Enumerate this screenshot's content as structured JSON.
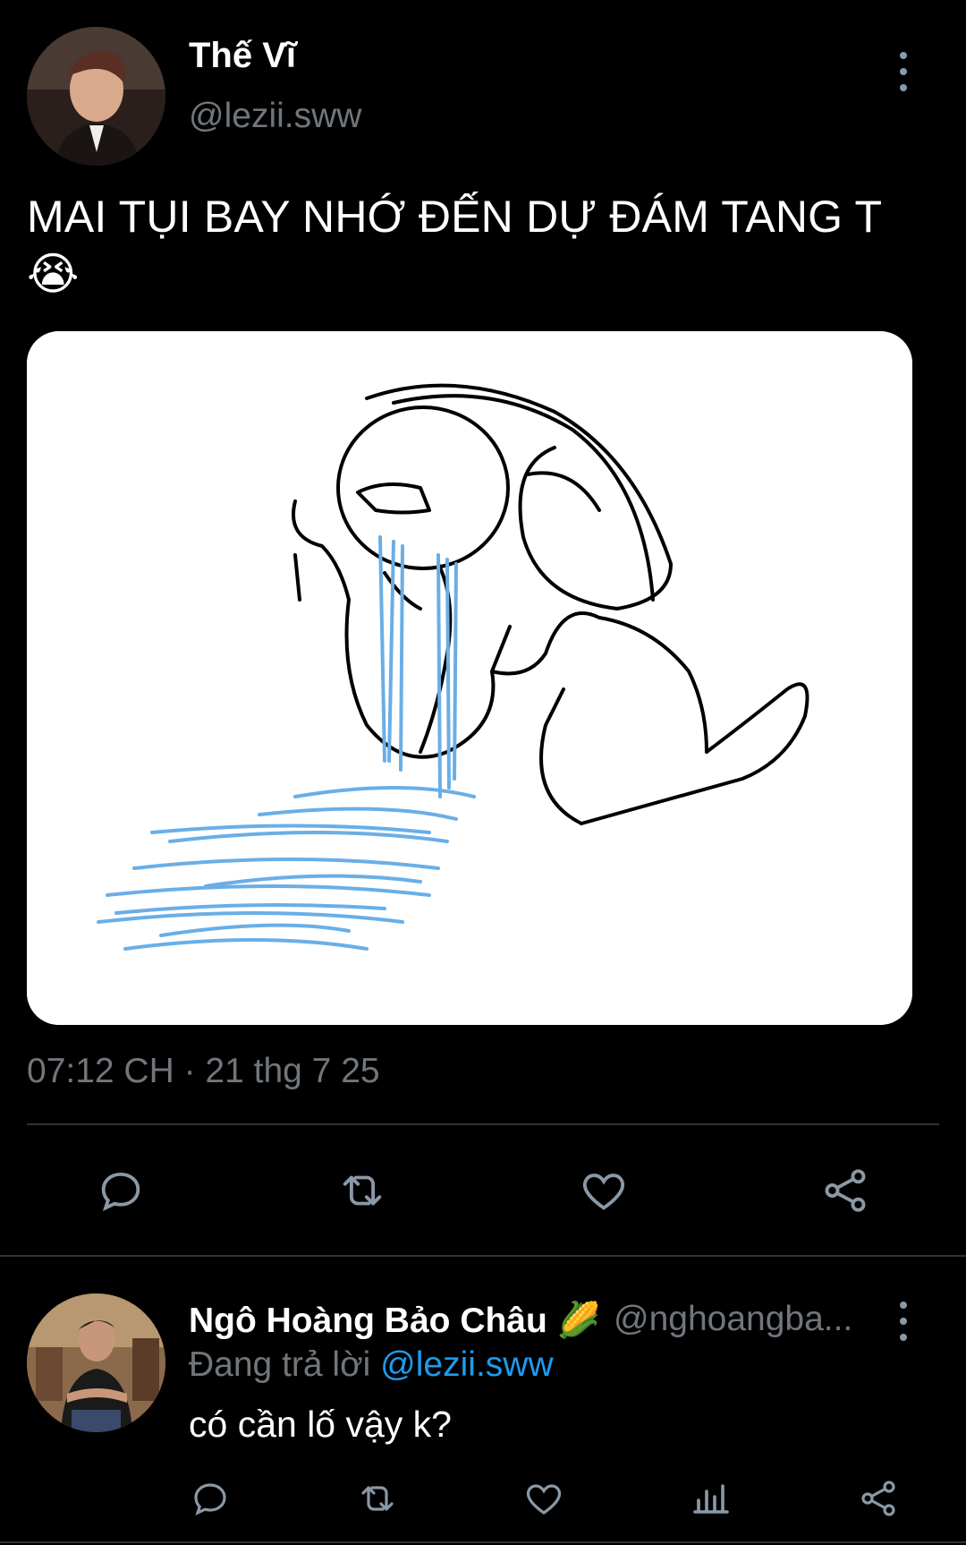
{
  "tweet": {
    "author_name": "Thế Vĩ",
    "author_handle": "@lezii.sww",
    "text": "MAI TỤI BAY NHỚ ĐẾN DỰ ĐÁM TANG T",
    "emoji": "😭",
    "timestamp": "07:12 CH · 21 thg 7 25",
    "actions": [
      "reply-icon",
      "retweet-icon",
      "like-icon",
      "share-icon"
    ]
  },
  "reply": {
    "author_name": "Ngô Hoàng Bảo Châu",
    "author_emoji": "🌽",
    "author_handle": "@nghoangba...",
    "context_prefix": "Đang trả lời",
    "context_mention": "@lezii.sww",
    "text": "có cần lố vậy k?",
    "actions": [
      "reply-icon",
      "retweet-icon",
      "like-icon",
      "analytics-icon",
      "share-icon"
    ]
  },
  "colors": {
    "background": "#000000",
    "text": "#ffffff",
    "muted": "#71767b",
    "link": "#1d9bf0",
    "divider": "#2f3336",
    "tears": "#6aaee6"
  }
}
